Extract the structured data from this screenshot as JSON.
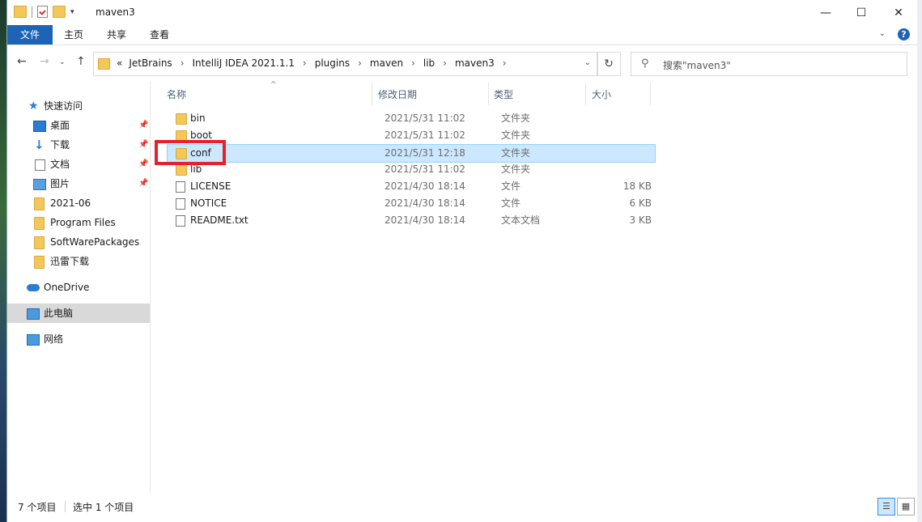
{
  "window": {
    "title": "maven3",
    "controls": {
      "minimize": "—",
      "maximize": "☐",
      "close": "✕"
    }
  },
  "ribbon": {
    "tabs": [
      "文件",
      "主页",
      "共享",
      "查看"
    ]
  },
  "address": {
    "prefix": "«",
    "crumbs": [
      "JetBrains",
      "IntelliJ IDEA 2021.1.1",
      "plugins",
      "maven",
      "lib",
      "maven3"
    ]
  },
  "search": {
    "placeholder": "搜索\"maven3\""
  },
  "navpane": {
    "items": [
      {
        "label": "快速访问",
        "icon": "star-icon",
        "pinned": false
      },
      {
        "label": "桌面",
        "icon": "desktop-icon",
        "pinned": true
      },
      {
        "label": "下载",
        "icon": "download-icon",
        "pinned": true
      },
      {
        "label": "文档",
        "icon": "document-icon",
        "pinned": true
      },
      {
        "label": "图片",
        "icon": "pictures-icon",
        "pinned": true
      },
      {
        "label": "2021-06",
        "icon": "folder-icon",
        "pinned": false
      },
      {
        "label": "Program Files",
        "icon": "folder-icon",
        "pinned": false
      },
      {
        "label": "SoftWarePackages",
        "icon": "folder-icon",
        "pinned": false
      },
      {
        "label": "迅雷下载",
        "icon": "folder-icon",
        "pinned": false
      },
      {
        "label": "OneDrive",
        "icon": "cloud-icon",
        "pinned": false
      },
      {
        "label": "此电脑",
        "icon": "computer-icon",
        "pinned": false,
        "selected": true
      },
      {
        "label": "网络",
        "icon": "network-icon",
        "pinned": false
      }
    ]
  },
  "columns": {
    "name": "名称",
    "date": "修改日期",
    "type": "类型",
    "size": "大小"
  },
  "files": [
    {
      "name": "bin",
      "date": "2021/5/31 11:02",
      "type": "文件夹",
      "size": "",
      "kind": "folder"
    },
    {
      "name": "boot",
      "date": "2021/5/31 11:02",
      "type": "文件夹",
      "size": "",
      "kind": "folder"
    },
    {
      "name": "conf",
      "date": "2021/5/31 12:18",
      "type": "文件夹",
      "size": "",
      "kind": "folder",
      "selected": true
    },
    {
      "name": "lib",
      "date": "2021/5/31 11:02",
      "type": "文件夹",
      "size": "",
      "kind": "folder"
    },
    {
      "name": "LICENSE",
      "date": "2021/4/30 18:14",
      "type": "文件",
      "size": "18 KB",
      "kind": "file"
    },
    {
      "name": "NOTICE",
      "date": "2021/4/30 18:14",
      "type": "文件",
      "size": "6 KB",
      "kind": "file"
    },
    {
      "name": "README.txt",
      "date": "2021/4/30 18:14",
      "type": "文本文档",
      "size": "3 KB",
      "kind": "file"
    }
  ],
  "status": {
    "item_count": "7 个项目",
    "selected_count": "选中 1 个项目"
  },
  "colors": {
    "accent": "#1d63b6",
    "selection": "#cce8ff",
    "highlight_box": "#e8202a"
  }
}
